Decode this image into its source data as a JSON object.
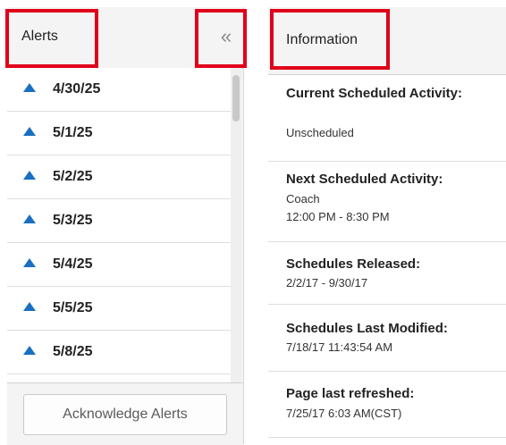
{
  "alerts": {
    "title": "Alerts",
    "collapse_icon": "double-chevron-left-icon",
    "accent_color": "#1a6fc2",
    "items": [
      {
        "date": "4/30/25"
      },
      {
        "date": "5/1/25"
      },
      {
        "date": "5/2/25"
      },
      {
        "date": "5/3/25"
      },
      {
        "date": "5/4/25"
      },
      {
        "date": "5/5/25"
      },
      {
        "date": "5/8/25"
      }
    ],
    "acknowledge_label": "Acknowledge Alerts"
  },
  "information": {
    "title": "Information",
    "sections": [
      {
        "label": "Current Scheduled Activity:",
        "values": [
          "Unscheduled"
        ]
      },
      {
        "label": "Next Scheduled Activity:",
        "values": [
          "Coach",
          "12:00 PM - 8:30 PM"
        ]
      },
      {
        "label": "Schedules Released:",
        "values": [
          "2/2/17 - 9/30/17"
        ]
      },
      {
        "label": "Schedules Last Modified:",
        "values": [
          "7/18/17 11:43:54 AM"
        ]
      },
      {
        "label": "Page last refreshed:",
        "values": [
          "7/25/17 6:03 AM(CST)"
        ]
      }
    ]
  },
  "highlight_color": "#e0001a"
}
